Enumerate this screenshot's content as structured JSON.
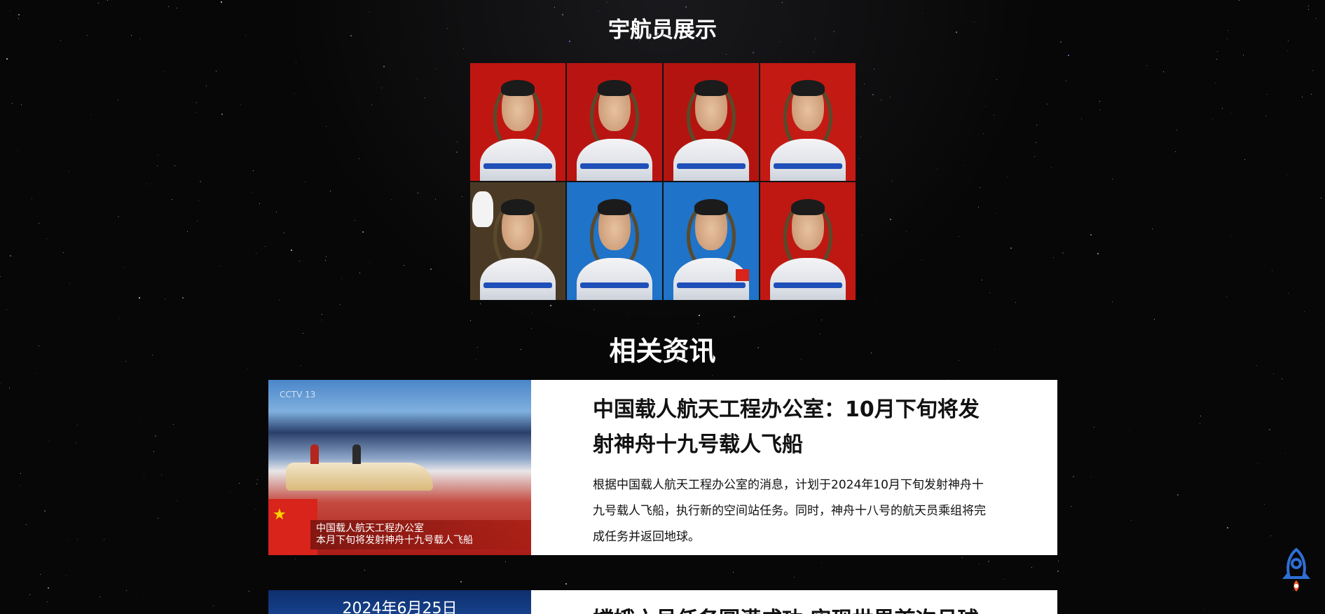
{
  "sections": {
    "astronauts_title": "宇航员展示",
    "news_title": "相关资讯"
  },
  "astronauts": [
    {
      "bg": "#c01612",
      "type": "red"
    },
    {
      "bg": "#b81512",
      "type": "red"
    },
    {
      "bg": "#b3140f",
      "type": "red"
    },
    {
      "bg": "#c41a14",
      "type": "red"
    },
    {
      "bg": "#4a3a25",
      "type": "waving"
    },
    {
      "bg": "#1f73c8",
      "type": "blue"
    },
    {
      "bg": "#1f73c8",
      "type": "blue-flag"
    },
    {
      "bg": "#bf1813",
      "type": "red"
    }
  ],
  "news": [
    {
      "title": "中国载人航天工程办公室：10月下旬将发射神舟十九号载人飞船",
      "description": "根据中国载人航天工程办公室的消息，计划于2024年10月下旬发射神舟十九号载人飞船，执行新的空间站任务。同时，神舟十八号的航天员乘组将完成任务并返回地球。",
      "thumb_caption_line1": "中国载人航天工程办公室",
      "thumb_caption_line2": "本月下旬将发射神舟十九号载人飞船"
    },
    {
      "title": "嫦娥六号任务圆满成功 实现世界首次月球",
      "thumb_date": "2024年6月25日"
    }
  ],
  "icons": {
    "rocket": "rocket-icon"
  },
  "colors": {
    "background": "#070707",
    "card": "#ffffff",
    "rocket_blue": "#2f6fd6",
    "rocket_flame": "#f05a24"
  }
}
